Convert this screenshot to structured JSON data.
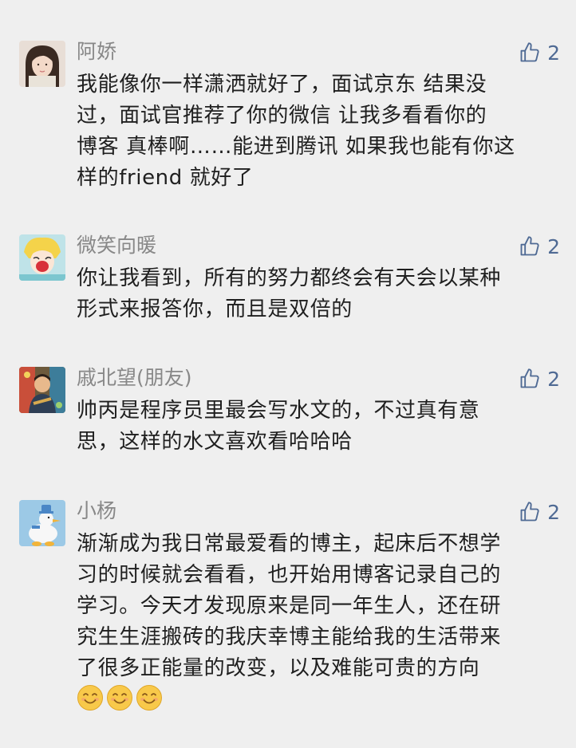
{
  "comments": [
    {
      "name": "阿娇",
      "likes": "2",
      "text": "我能像你一样潇洒就好了，面试京东 结果没\n过，面试官推荐了你的微信 让我多看看你的\n博客 真棒啊……能进到腾讯 如果我也能有你这\n样的friend 就好了"
    },
    {
      "name": "微笑向暖",
      "likes": "2",
      "text": "你让我看到，所有的努力都终会有天会以某种\n形式来报答你，而且是双倍的"
    },
    {
      "name": "戚北望(朋友)",
      "likes": "2",
      "text": "帅丙是程序员里最会写水文的，不过真有意\n思，这样的水文喜欢看哈哈哈"
    },
    {
      "name": "小杨",
      "likes": "2",
      "text": "渐渐成为我日常最爱看的博主，起床后不想学\n习的时候就会看看，也开始用博客记录自己的\n学习。今天才发现原来是同一年生人，还在研\n究生生涯搬砖的我庆幸博主能给我的生活带来\n了很多正能量的改变，以及难能可贵的方向",
      "emojis": [
        "smile-emoji",
        "smile-emoji",
        "smile-emoji"
      ]
    }
  ],
  "icons": {
    "like": "thumbs-up-icon"
  },
  "colors": {
    "background": "#efefef",
    "name": "#888888",
    "like": "#4f6a94",
    "text": "#1f1f1f"
  }
}
